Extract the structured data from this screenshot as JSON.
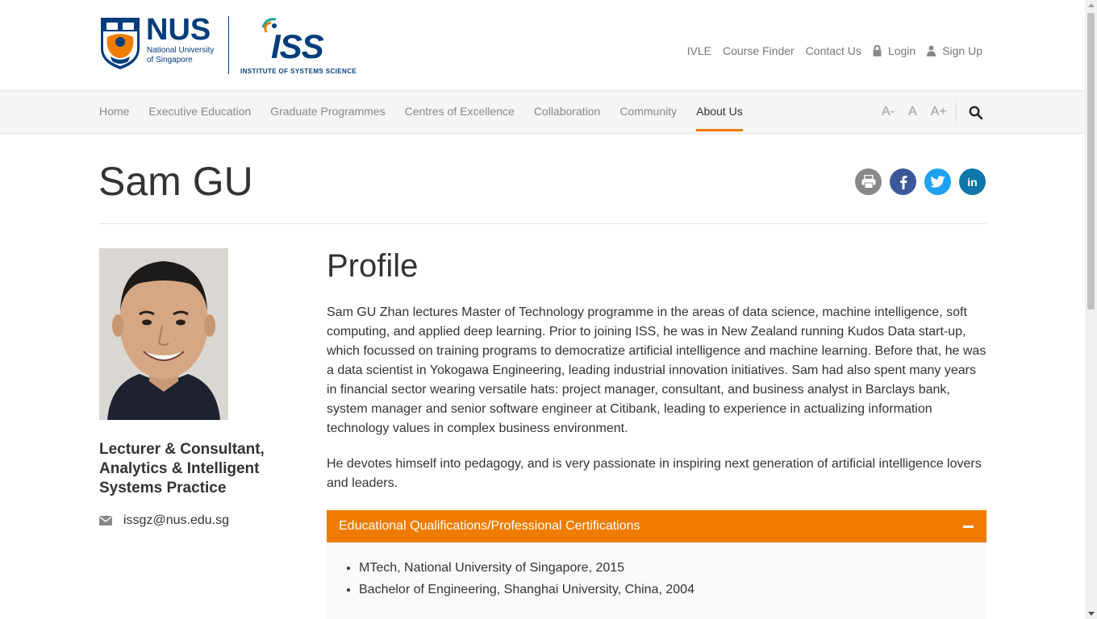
{
  "header": {
    "nus_logo": {
      "word": "NUS",
      "subtitle_line1": "National University",
      "subtitle_line2": "of Singapore"
    },
    "iss_logo": {
      "word": "ISS",
      "subtitle": "INSTITUTE OF SYSTEMS SCIENCE"
    },
    "top_links": [
      {
        "label": "IVLE"
      },
      {
        "label": "Course Finder"
      },
      {
        "label": "Contact Us"
      },
      {
        "label": "Login",
        "icon": "lock-icon"
      },
      {
        "label": "Sign Up",
        "icon": "user-icon"
      }
    ]
  },
  "nav": {
    "items": [
      {
        "label": "Home"
      },
      {
        "label": "Executive Education"
      },
      {
        "label": "Graduate Programmes"
      },
      {
        "label": "Centres of Excellence"
      },
      {
        "label": "Collaboration"
      },
      {
        "label": "Community"
      },
      {
        "label": "About Us"
      }
    ],
    "active": "About Us",
    "font_controls": [
      "A-",
      "A",
      "A+"
    ]
  },
  "page": {
    "title": "Sam GU",
    "share_icons": [
      "print-icon",
      "facebook-icon",
      "twitter-icon",
      "linkedin-icon"
    ]
  },
  "person": {
    "role": "Lecturer & Consultant, Analytics & Intelligent Systems Practice",
    "email": "issgz@nus.edu.sg"
  },
  "profile": {
    "heading": "Profile",
    "paragraph1": "Sam GU Zhan lectures Master of Technology programme in the areas of data science, machine intelligence, soft computing, and applied deep learning. Prior to joining ISS, he was in New Zealand running Kudos Data start-up, which focussed on training programs to democratize artificial intelligence and machine learning.  Before that, he was a data scientist in Yokogawa Engineering, leading industrial innovation initiatives.  Sam had also spent many years in financial sector wearing versatile hats: project manager, consultant, and business analyst in Barclays bank, system manager and senior software engineer at Citibank, leading to experience in actualizing information technology values in complex business environment.",
    "paragraph2": "He devotes himself into pedagogy, and is very passionate in inspiring next generation of artificial intelligence lovers and leaders."
  },
  "qualifications": {
    "title": "Educational Qualifications/Professional Certifications",
    "items": [
      "MTech, National University of Singapore, 2015",
      "Bachelor of Engineering, Shanghai University, China, 2004"
    ]
  },
  "colors": {
    "accent": "#ef7c00",
    "nus_blue": "#003d7c"
  }
}
